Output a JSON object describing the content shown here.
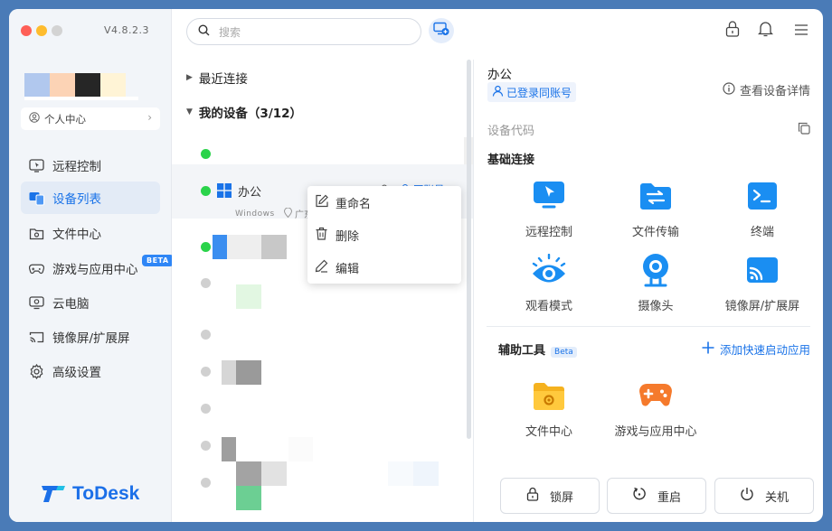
{
  "app": {
    "version": "V4.8.2.3",
    "brand": "ToDesk",
    "accent": "#1a73e8"
  },
  "sidebar": {
    "profile_label": "个人中心",
    "items": [
      {
        "label": "远程控制",
        "icon": "remote-control-icon"
      },
      {
        "label": "设备列表",
        "icon": "device-list-icon",
        "active": true
      },
      {
        "label": "文件中心",
        "icon": "file-center-icon"
      },
      {
        "label": "游戏与应用中心",
        "icon": "gamepad-icon",
        "badge": "BETA"
      },
      {
        "label": "云电脑",
        "icon": "cloud-pc-icon"
      },
      {
        "label": "镜像屏/扩展屏",
        "icon": "screen-cast-icon"
      },
      {
        "label": "高级设置",
        "icon": "gear-icon"
      }
    ]
  },
  "topbar": {
    "search_placeholder": "搜索"
  },
  "device_list": {
    "recent_label": "最近连接",
    "my_devices_label": "我的设备（3/12）",
    "selected_device": {
      "name": "办公",
      "os": "Windows",
      "location": "广东",
      "account_label": "同账号"
    }
  },
  "context_menu": {
    "items": [
      "重命名",
      "删除",
      "编辑"
    ]
  },
  "detail": {
    "device_name": "办公",
    "same_account_label": "已登录同账号",
    "details_link": "查看设备详情",
    "device_code_label": "设备代码",
    "basic_title": "基础连接",
    "features": [
      {
        "label": "远程控制",
        "icon": "remote-control-icon"
      },
      {
        "label": "文件传输",
        "icon": "file-transfer-icon"
      },
      {
        "label": "终端",
        "icon": "terminal-icon"
      },
      {
        "label": "观看模式",
        "icon": "eye-icon"
      },
      {
        "label": "摄像头",
        "icon": "camera-icon"
      },
      {
        "label": "镜像屏/扩展屏",
        "icon": "screen-cast-icon"
      }
    ],
    "tools_title": "辅助工具",
    "tools_beta": "Beta",
    "add_quick_label": "添加快速启动应用",
    "tools": [
      {
        "label": "文件中心",
        "icon": "folder-icon"
      },
      {
        "label": "游戏与应用中心",
        "icon": "gamepad-icon"
      }
    ],
    "actions": [
      {
        "label": "锁屏",
        "icon": "lock-icon"
      },
      {
        "label": "重启",
        "icon": "restart-icon"
      },
      {
        "label": "关机",
        "icon": "power-icon"
      }
    ]
  }
}
